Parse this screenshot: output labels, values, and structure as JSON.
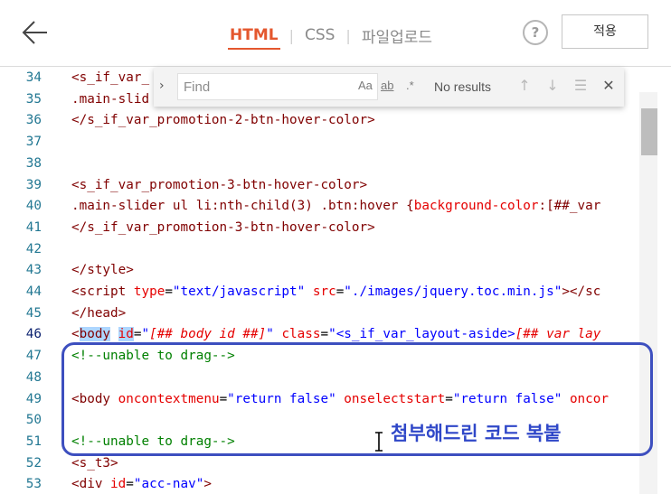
{
  "header": {
    "tabs": [
      {
        "label": "HTML",
        "active": true
      },
      {
        "label": "CSS",
        "active": false
      },
      {
        "label": "파일업로드",
        "active": false
      }
    ],
    "help_label": "?",
    "apply_label": "적용",
    "accent_color": "#e4572e"
  },
  "find": {
    "placeholder": "Find",
    "match_case_label": "Aa",
    "whole_word_label": "ab",
    "regex_label": ".*",
    "status": "No results"
  },
  "editor": {
    "lines": [
      {
        "num": "34",
        "segments": [
          {
            "t": "<s_if_var_",
            "c": "tag"
          }
        ]
      },
      {
        "num": "35",
        "segments": [
          {
            "t": ".main-slid",
            "c": "tag"
          }
        ]
      },
      {
        "num": "36",
        "segments": [
          {
            "t": "</s_if_var_promotion-2-btn-hover-color>",
            "c": "tag"
          }
        ]
      },
      {
        "num": "37",
        "segments": []
      },
      {
        "num": "38",
        "segments": []
      },
      {
        "num": "39",
        "segments": [
          {
            "t": "<s_if_var_promotion-3-btn-hover-color>",
            "c": "tag"
          }
        ]
      },
      {
        "num": "40",
        "segments": [
          {
            "t": ".main-slider ul li:nth-child(3) .btn:hover {",
            "c": "tag"
          },
          {
            "t": "background-color",
            "c": "attr"
          },
          {
            "t": ":[##_var",
            "c": "tag"
          }
        ]
      },
      {
        "num": "41",
        "segments": [
          {
            "t": "</s_if_var_promotion-3-btn-hover-color>",
            "c": "tag"
          }
        ]
      },
      {
        "num": "42",
        "segments": []
      },
      {
        "num": "43",
        "segments": [
          {
            "t": "</style>",
            "c": "tag"
          }
        ]
      },
      {
        "num": "44",
        "segments": [
          {
            "t": "<script ",
            "c": "tag"
          },
          {
            "t": "type",
            "c": "attr"
          },
          {
            "t": "=",
            "c": "plain"
          },
          {
            "t": "\"text/javascript\"",
            "c": "str"
          },
          {
            "t": " ",
            "c": "plain"
          },
          {
            "t": "src",
            "c": "attr"
          },
          {
            "t": "=",
            "c": "plain"
          },
          {
            "t": "\"./images/jquery.toc.min.js\"",
            "c": "str"
          },
          {
            "t": "></sc",
            "c": "tag"
          }
        ]
      },
      {
        "num": "45",
        "segments": [
          {
            "t": "</head>",
            "c": "tag"
          }
        ]
      },
      {
        "num": "46",
        "current": true,
        "segments": [
          {
            "t": "<",
            "c": "tag"
          },
          {
            "t": "body",
            "c": "tag",
            "sel": true
          },
          {
            "t": " ",
            "c": "plain"
          },
          {
            "t": "id",
            "c": "attr",
            "sel": true
          },
          {
            "t": "=",
            "c": "plain"
          },
          {
            "t": "\"",
            "c": "str"
          },
          {
            "t": "[## body id ##]",
            "c": "italic"
          },
          {
            "t": "\" ",
            "c": "str"
          },
          {
            "t": "class",
            "c": "attr"
          },
          {
            "t": "=",
            "c": "plain"
          },
          {
            "t": "\"<s_if_var_layout-aside>",
            "c": "str"
          },
          {
            "t": "[## var lay",
            "c": "italic"
          }
        ]
      },
      {
        "num": "47",
        "segments": [
          {
            "t": "<!--unable to drag-->",
            "c": "comment"
          }
        ]
      },
      {
        "num": "48",
        "segments": []
      },
      {
        "num": "49",
        "segments": [
          {
            "t": "<body ",
            "c": "tag"
          },
          {
            "t": "oncontextmenu",
            "c": "attr"
          },
          {
            "t": "=",
            "c": "plain"
          },
          {
            "t": "\"return false\"",
            "c": "str"
          },
          {
            "t": " ",
            "c": "plain"
          },
          {
            "t": "onselectstart",
            "c": "attr"
          },
          {
            "t": "=",
            "c": "plain"
          },
          {
            "t": "\"return false\"",
            "c": "str"
          },
          {
            "t": " ",
            "c": "plain"
          },
          {
            "t": "oncor",
            "c": "attr"
          }
        ]
      },
      {
        "num": "50",
        "segments": []
      },
      {
        "num": "51",
        "segments": [
          {
            "t": "<!--unable to drag-->",
            "c": "comment"
          }
        ]
      },
      {
        "num": "52",
        "segments": [
          {
            "t": "<s_t3>",
            "c": "tag"
          }
        ]
      },
      {
        "num": "53",
        "segments": [
          {
            "t": "<div ",
            "c": "tag"
          },
          {
            "t": "id",
            "c": "attr"
          },
          {
            "t": "=",
            "c": "plain"
          },
          {
            "t": "\"acc-nav\"",
            "c": "str"
          },
          {
            "t": ">",
            "c": "tag"
          }
        ]
      }
    ]
  },
  "annotation": {
    "text": "첨부해드린 코드 복붙",
    "color": "#2f47c8"
  }
}
